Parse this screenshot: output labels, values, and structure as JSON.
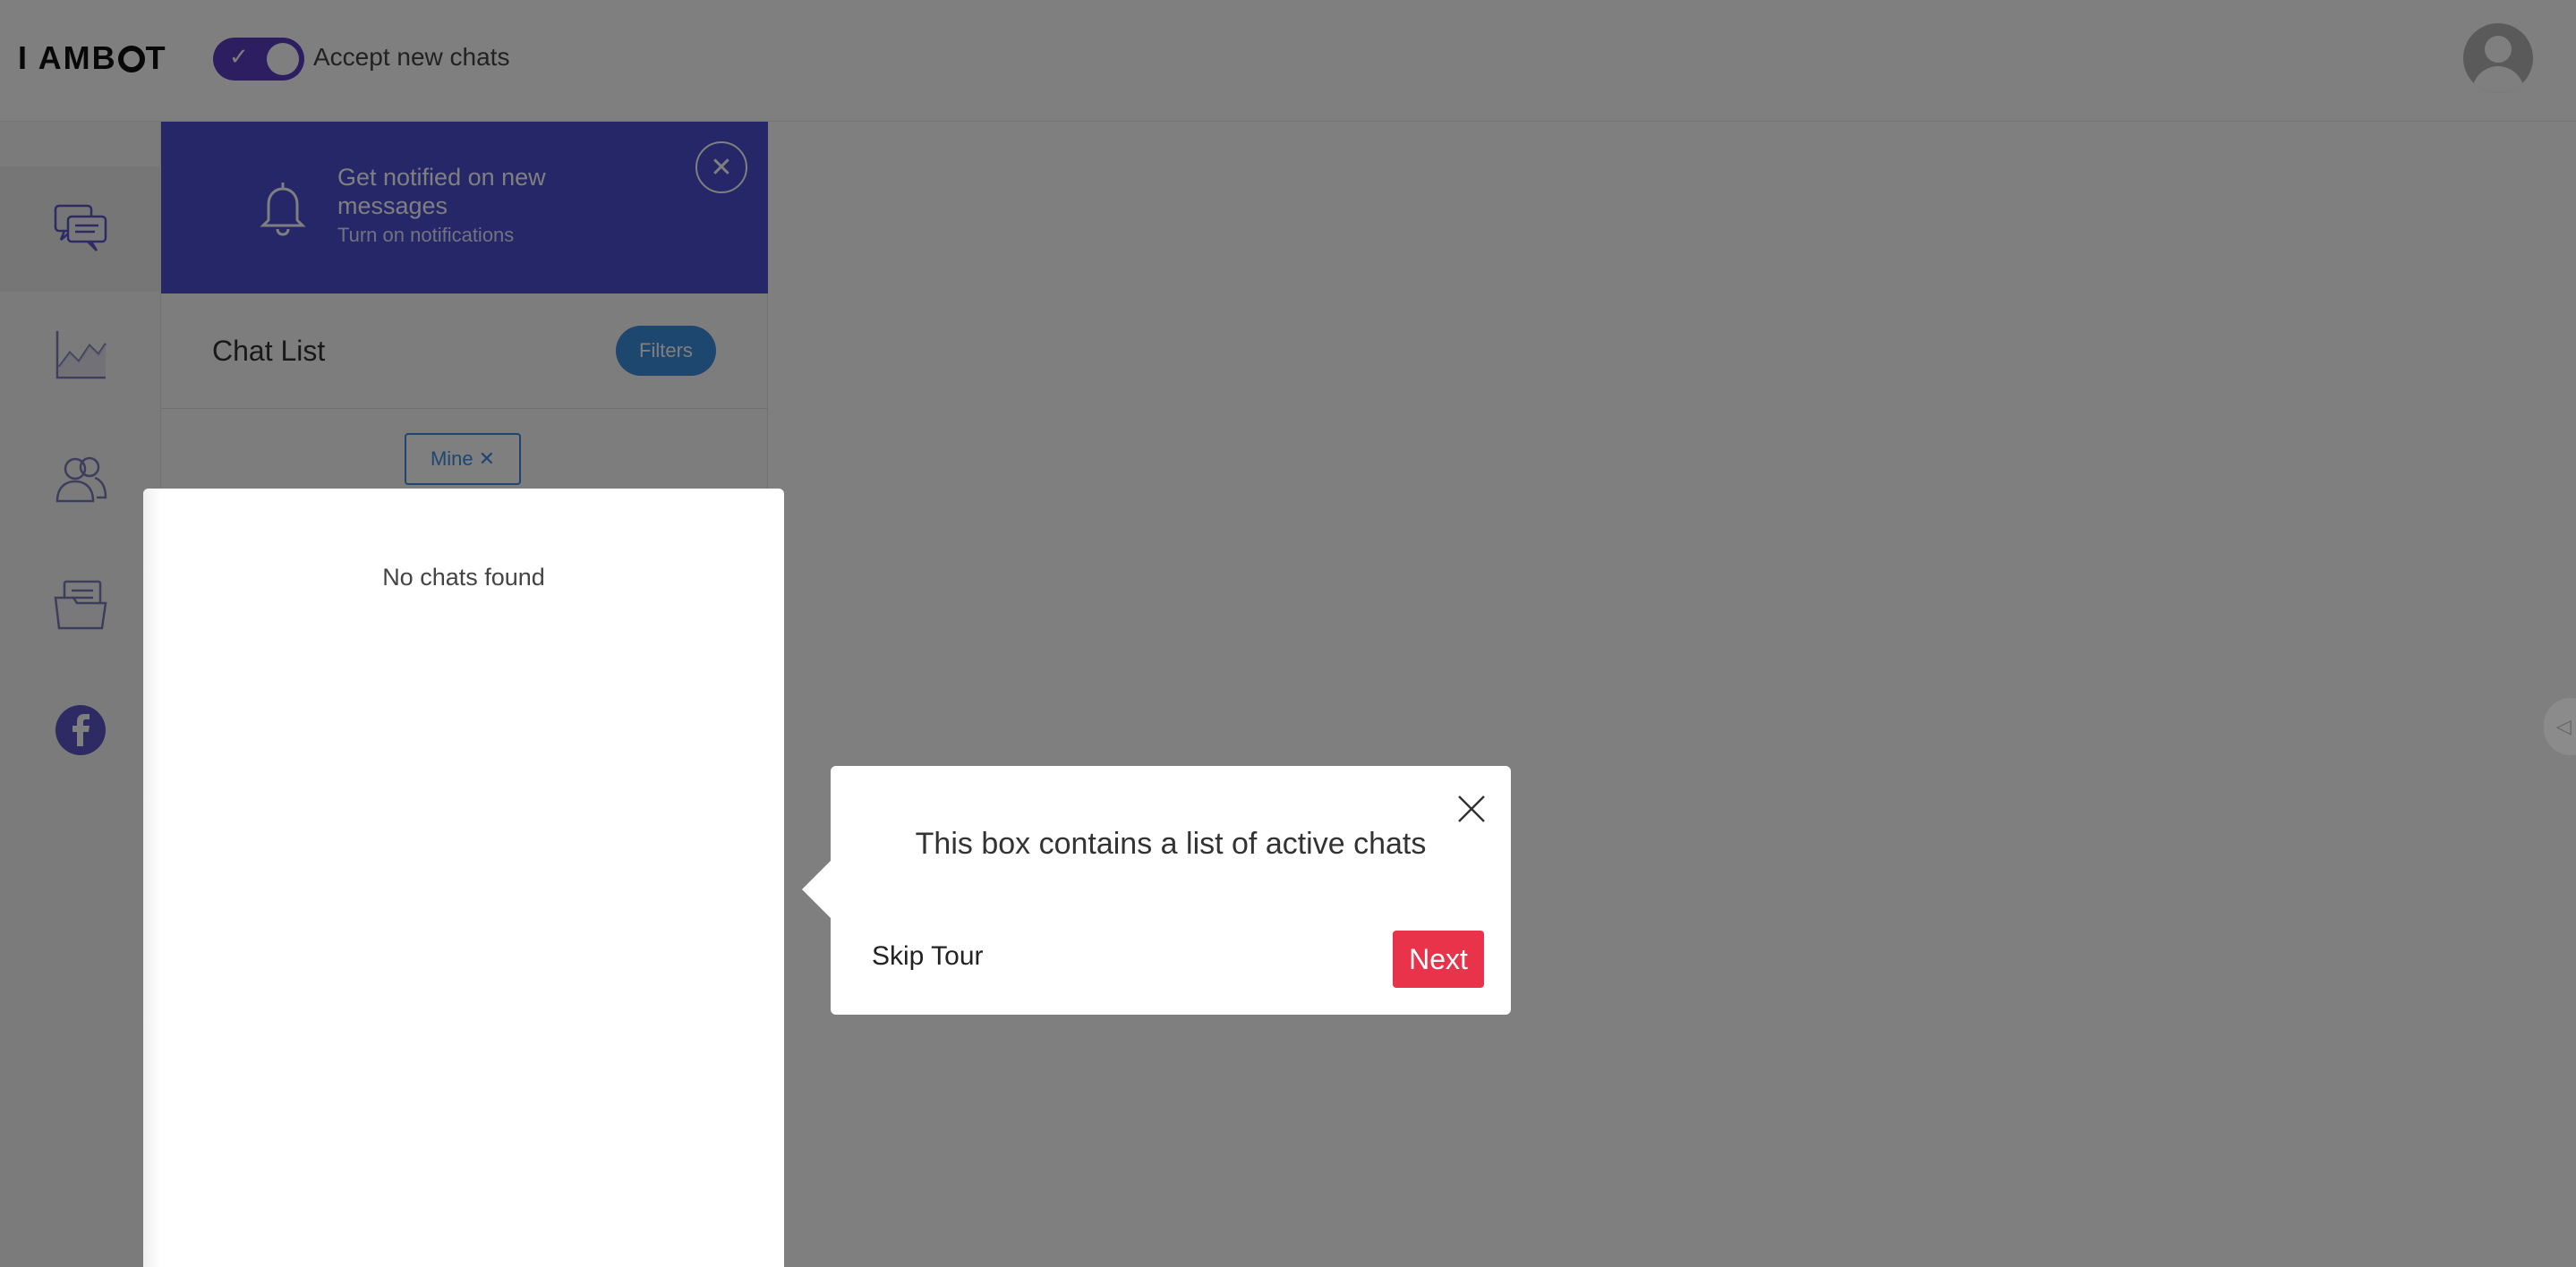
{
  "header": {
    "logo_text_a": "I AMB",
    "logo_text_b": "T",
    "accept_toggle_label": "Accept new chats",
    "accept_toggle_on": true
  },
  "sidebar": {
    "items": [
      {
        "icon": "chat-bubbles-icon",
        "active": true
      },
      {
        "icon": "analytics-chart-icon",
        "active": false
      },
      {
        "icon": "users-icon",
        "active": false
      },
      {
        "icon": "folder-documents-icon",
        "active": false
      },
      {
        "icon": "facebook-icon",
        "active": false
      }
    ]
  },
  "notification_banner": {
    "title": "Get notified on new messages",
    "subtitle": "Turn on notifications",
    "close_icon": "close-icon"
  },
  "chat_list": {
    "title": "Chat List",
    "filters_label": "Filters",
    "active_filter_tag": "Mine",
    "empty_text": "No chats found"
  },
  "tour": {
    "message": "This box contains a list of active chats",
    "skip_label": "Skip Tour",
    "next_label": "Next"
  },
  "colors": {
    "accent_purple": "#5a3dc4",
    "banner_blue": "#4a4fd0",
    "filter_blue": "#3d8ee0",
    "next_red": "#e8334a"
  }
}
